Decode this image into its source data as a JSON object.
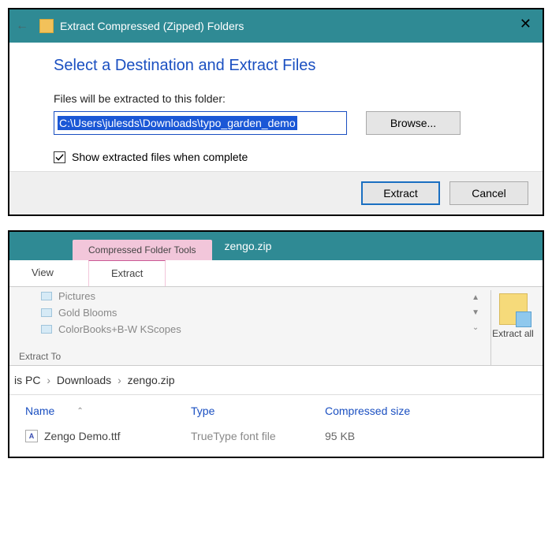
{
  "dialog": {
    "title": "Extract Compressed (Zipped) Folders",
    "heading": "Select a Destination and Extract Files",
    "path_label": "Files will be extracted to this folder:",
    "path_value": "C:\\Users\\julesds\\Downloads\\typo_garden_demo",
    "browse_label": "Browse...",
    "show_checkbox_label": "Show extracted files when complete",
    "extract_label": "Extract",
    "cancel_label": "Cancel"
  },
  "explorer": {
    "context_tab": "Compressed Folder Tools",
    "archive_name": "zengo.zip",
    "tabs": {
      "view": "View",
      "extract": "Extract"
    },
    "destinations": [
      "Pictures",
      "Gold Blooms",
      "ColorBooks+B-W KScopes"
    ],
    "group_label": "Extract To",
    "extract_all_label": "Extract all",
    "breadcrumb": [
      "is PC",
      "Downloads",
      "zengo.zip"
    ],
    "columns": {
      "name": "Name",
      "type": "Type",
      "size": "Compressed size"
    },
    "file": {
      "name": "Zengo Demo.ttf",
      "type": "TrueType font file",
      "size": "95 KB"
    }
  }
}
